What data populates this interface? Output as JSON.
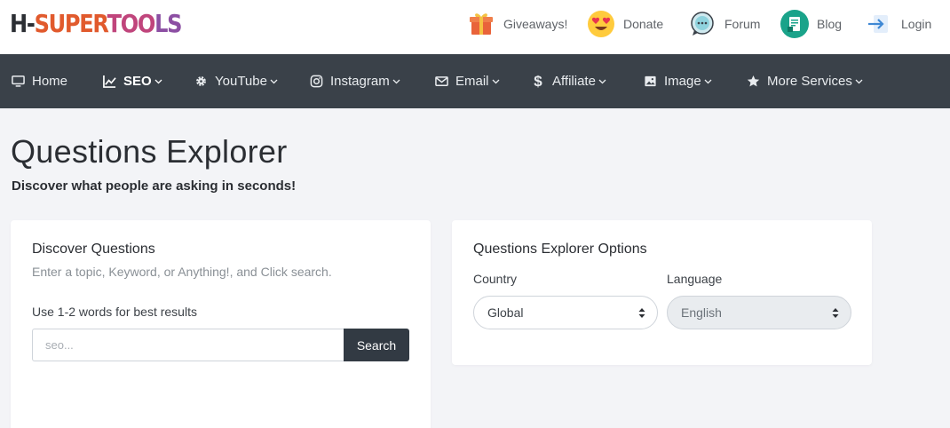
{
  "brand": {
    "part1": "H-",
    "part2": "SUPER",
    "part3": "TOO",
    "part4": "LS"
  },
  "top_links": [
    {
      "label": "Giveaways!",
      "icon": "gift-icon"
    },
    {
      "label": "Donate",
      "icon": "heart-eyes-emoji-icon"
    },
    {
      "label": "Forum",
      "icon": "chat-bubble-icon"
    },
    {
      "label": "Blog",
      "icon": "document-icon"
    },
    {
      "label": "Login",
      "icon": "login-arrow-icon"
    }
  ],
  "nav": [
    {
      "label": "Home",
      "icon": "monitor-icon",
      "dropdown": false
    },
    {
      "label": "SEO",
      "icon": "chart-icon",
      "dropdown": true,
      "active": true
    },
    {
      "label": "YouTube",
      "icon": "gear-icon",
      "dropdown": true
    },
    {
      "label": "Instagram",
      "icon": "instagram-icon",
      "dropdown": true
    },
    {
      "label": "Email",
      "icon": "envelope-icon",
      "dropdown": true
    },
    {
      "label": "Affiliate",
      "icon": "dollar-icon",
      "dropdown": true
    },
    {
      "label": "Image",
      "icon": "image-icon",
      "dropdown": true
    },
    {
      "label": "More Services",
      "icon": "star-icon",
      "dropdown": true
    }
  ],
  "page": {
    "title": "Questions Explorer",
    "subtitle": "Discover what people are asking in seconds!"
  },
  "discover": {
    "title": "Discover Questions",
    "hint": "Enter a topic, Keyword, or Anything!, and Click search.",
    "tip": "Use 1-2 words for best results",
    "input_placeholder": "seo...",
    "input_value": "",
    "search_label": "Search"
  },
  "options": {
    "title": "Questions Explorer Options",
    "country_label": "Country",
    "country_value": "Global",
    "language_label": "Language",
    "language_value": "English"
  },
  "colors": {
    "nav_bg": "#3a4149",
    "page_bg": "#f3f4f7",
    "search_button": "#323a43",
    "logo_orange": "#e15a2d",
    "logo_pink": "#c0457c",
    "logo_purple": "#8c4fa3"
  }
}
